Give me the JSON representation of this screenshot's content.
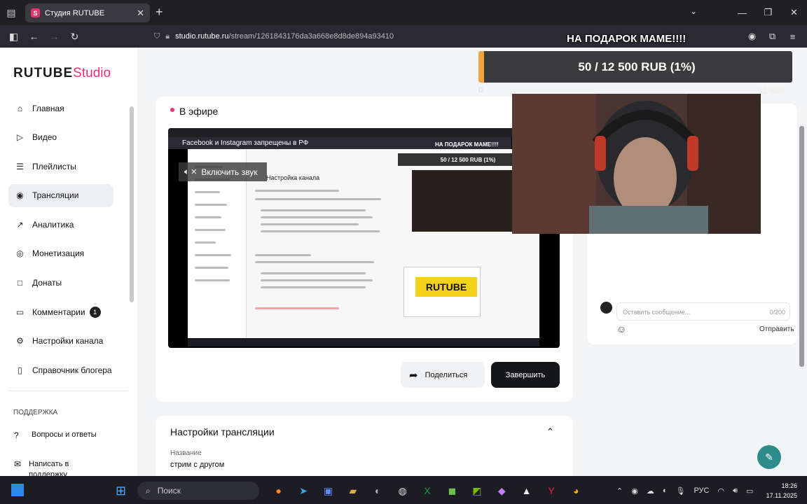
{
  "browser": {
    "tab_title": "Студия RUTUBE",
    "tab_favicon": "S",
    "new_tab": "+",
    "url_host": "studio.rutube.ru",
    "url_path": "/stream/1261843176da3a668e8d8de894a93410"
  },
  "sidebar": {
    "logo_main": "RUTUBE",
    "logo_studio": "Studio",
    "items": [
      {
        "label": "Главная",
        "icon": "home-icon",
        "glyph": "⌂"
      },
      {
        "label": "Видео",
        "icon": "video-icon",
        "glyph": "▷"
      },
      {
        "label": "Плейлисты",
        "icon": "playlist-icon",
        "glyph": "☰"
      },
      {
        "label": "Трансляции",
        "icon": "broadcast-icon",
        "glyph": "◉"
      },
      {
        "label": "Аналитика",
        "icon": "analytics-icon",
        "glyph": "↗"
      },
      {
        "label": "Монетизация",
        "icon": "money-icon",
        "glyph": "◎"
      },
      {
        "label": "Донаты",
        "icon": "donate-icon",
        "glyph": "□"
      },
      {
        "label": "Комментарии",
        "icon": "comments-icon",
        "glyph": "▭",
        "badge": "1"
      },
      {
        "label": "Настройки канала",
        "icon": "settings-icon",
        "glyph": "⚙"
      },
      {
        "label": "Справочник блогера",
        "icon": "book-icon",
        "glyph": "▯"
      }
    ],
    "support_heading": "ПОДДЕРЖКА",
    "support_items": [
      {
        "label": "Вопросы и ответы",
        "icon": "question-icon",
        "glyph": "?"
      },
      {
        "label": "Написать в поддержку",
        "icon": "mail-icon",
        "glyph": "✉"
      }
    ]
  },
  "stream": {
    "live_label": "В эфире",
    "embedded_title": "Facebook и Instagram запрещены в РФ",
    "embedded_heading": "Настройка канала",
    "embedded_donate": "50 / 12 500 RUB (1%)",
    "embedded_donate_top": "НА ПОДАРОК МАМЕ!!!!",
    "embedded_cover_text": "RUTUBE",
    "unmute_label": "Включить звук",
    "share_label": "Поделиться",
    "end_label": "Завершить"
  },
  "settings": {
    "title": "Настройки трансляции",
    "name_label": "Название",
    "name_value": "стрим с другом"
  },
  "donation": {
    "caption": "НА ПОДАРОК МАМЕ!!!!",
    "progress_text": "50 / 12 500 RUB (1%)",
    "current": 50,
    "goal": 12500,
    "fraction": 0.01,
    "min_label": "0",
    "max_label": "12 500",
    "accent": "#f2a33a"
  },
  "chat": {
    "placeholder": "Оставить сообщение...",
    "counter": "0/200",
    "send_label": "Отправить"
  },
  "taskbar": {
    "search_label": "Поиск",
    "lang": "РУС",
    "time": "18:26",
    "date": "17.11.2025"
  },
  "colors": {
    "brand": "#e8346d",
    "accent": "#f2a33a"
  }
}
